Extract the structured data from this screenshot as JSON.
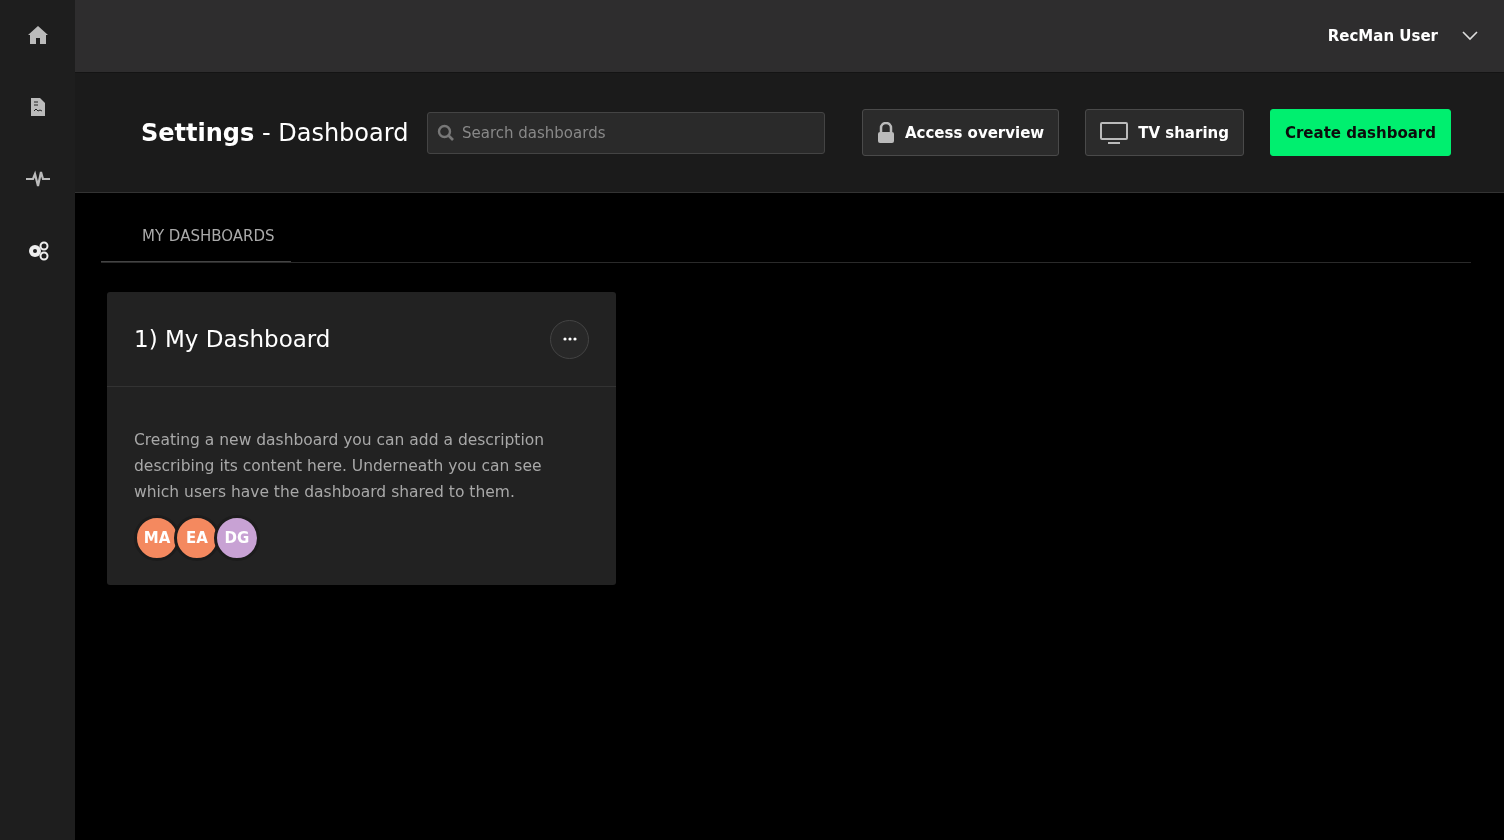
{
  "sidebar": {
    "items": [
      {
        "kind": "home"
      },
      {
        "kind": "document"
      },
      {
        "kind": "pulse"
      },
      {
        "kind": "gears"
      }
    ]
  },
  "topbar": {
    "user": "RecMan User"
  },
  "header": {
    "title": "**Settings** - Dashboard",
    "search": {
      "placeholder": "Search dashboards"
    },
    "buttons": [
      {
        "kind": "lock",
        "label": "Access overview"
      },
      {
        "kind": "tv",
        "label": "TV sharing"
      },
      {
        "kind": "primary",
        "label": "Create dashboard"
      }
    ]
  },
  "tabs": [
    {
      "label": "MY DASHBOARDS",
      "selected": true
    }
  ],
  "dashboards": [
    {
      "title": "1) My Dashboard",
      "description": "Creating a new dashboard you can add a description describing its content here. Underneath you can see which users have the dashboard shared to them.",
      "users": [
        {
          "initials": "MA",
          "color": "#f4895f"
        },
        {
          "initials": "EA",
          "color": "#f4895f"
        },
        {
          "initials": "DG",
          "color": "#c8a2d4"
        }
      ]
    }
  ]
}
